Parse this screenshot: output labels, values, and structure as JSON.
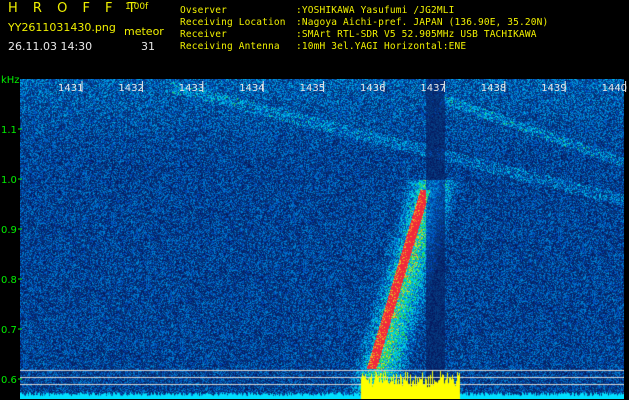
{
  "header": {
    "title": "H R O F F T",
    "version": "1.00f",
    "filename": "YY2611031430.png",
    "meteor_label": "meteor",
    "datetime": "26.11.03 14:30",
    "meteor_count": "31"
  },
  "info": {
    "rows": [
      {
        "label": "Ovserver",
        "value": ":YOSHIKAWA Yasufumi /JG2MLI"
      },
      {
        "label": "Receiving Location",
        "value": ":Nagoya Aichi-pref. JAPAN (136.90E, 35.20N)"
      },
      {
        "label": "Receiver",
        "value": ":SMArt RTL-SDR V5 52.905MHz USB TACHIKAWA"
      },
      {
        "label": "Receiving Antenna",
        "value": ":10mH 3el.YAGI Horizontal:ENE"
      }
    ]
  },
  "axes": {
    "y_unit": "kHz",
    "y_ticks": [
      "1.1",
      "1.0",
      "0.9",
      "0.8",
      "0.7",
      "0.6"
    ],
    "x_ticks": [
      "1431",
      "1432",
      "1433",
      "1434",
      "1435",
      "1436",
      "1437",
      "1438",
      "1439",
      "1440"
    ]
  },
  "colors": {
    "background": "#000000",
    "title": "#f0f000",
    "label": "#00f000",
    "info": "#e8e8e8",
    "plot_bg": "#0a1a6e",
    "noise_floor": "#00e0ff",
    "meteor_power": "#ffff00"
  }
}
